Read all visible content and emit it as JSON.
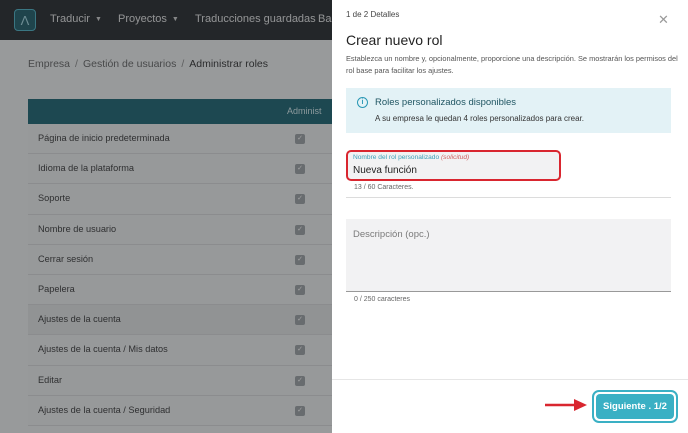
{
  "nav": {
    "logo_glyph": "Λ",
    "items": [
      {
        "label": "Traducir",
        "has_menu": true
      },
      {
        "label": "Proyectos",
        "has_menu": true
      },
      {
        "label": "Traducciones guardadas",
        "has_menu": false
      },
      {
        "label": "Ba",
        "has_menu": false
      }
    ]
  },
  "breadcrumb": {
    "items": [
      "Empresa",
      "Gestión de usuarios"
    ],
    "current": "Administrar roles",
    "separator": "/"
  },
  "table": {
    "header": "Administ",
    "rows": [
      {
        "label": "Página de inicio predeterminada",
        "checked": true
      },
      {
        "label": "Idioma de la plataforma",
        "checked": true
      },
      {
        "label": "Soporte",
        "checked": true
      },
      {
        "label": "Nombre de usuario",
        "checked": true
      },
      {
        "label": "Cerrar sesión",
        "checked": true
      },
      {
        "label": "Papelera",
        "checked": true
      },
      {
        "label": "Ajustes de la cuenta",
        "checked": true
      },
      {
        "label": "Ajustes de la cuenta / Mis datos",
        "checked": true
      },
      {
        "label": "Editar",
        "checked": true
      },
      {
        "label": "Ajustes de la cuenta / Seguridad",
        "checked": true
      }
    ]
  },
  "panel": {
    "step": "1 de 2 Detalles",
    "title": "Crear nuevo rol",
    "description": "Establezca un nombre y, opcionalmente, proporcione una descripción. Se mostrarán los permisos del rol base para facilitar los ajustes.",
    "info": {
      "title": "Roles personalizados disponibles",
      "text": "A su empresa le quedan 4 roles personalizados para crear."
    },
    "name_field": {
      "label": "Nombre del rol personalizado",
      "required_note": "(solicitud)",
      "value": "Nueva función",
      "counter": "13 / 60 Caracteres."
    },
    "description_field": {
      "placeholder": "Descripción (opc.)",
      "value": "",
      "counter": "0 / 250 caracteres"
    },
    "next_button": "Siguiente . 1/2"
  },
  "colors": {
    "accent": "#3ab0c4",
    "highlight_red": "#d9262f",
    "nav_bg": "#262a2e",
    "table_header": "#1d6472"
  }
}
